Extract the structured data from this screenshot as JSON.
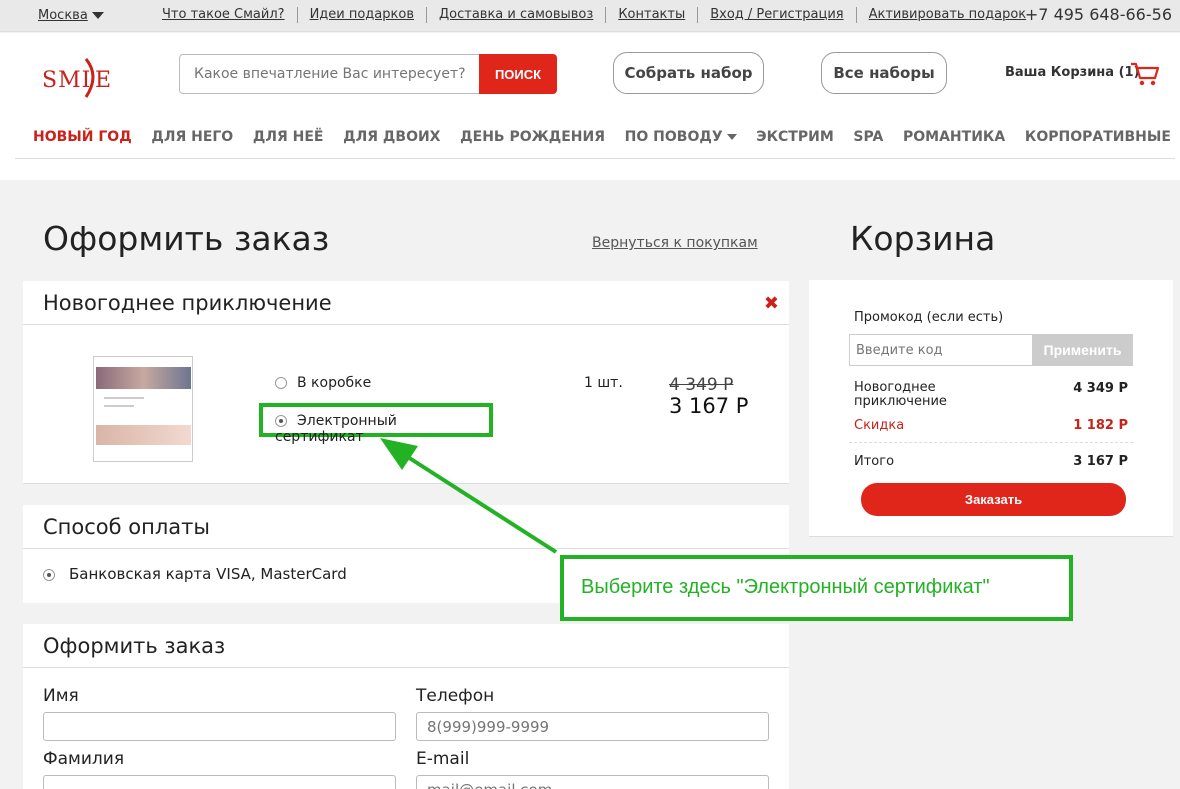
{
  "topbar": {
    "city": "Москва",
    "links": [
      "Что такое Смайл?",
      "Идеи подарков",
      "Доставка и самовывоз",
      "Контакты",
      "Вход / Регистрация",
      "Активировать подарок"
    ],
    "phone": "+7 495 648-66-56"
  },
  "header": {
    "logo": "SMILE",
    "search_placeholder": "Какое впечатление Вас интересует?",
    "search_button": "ПОИСК",
    "build_set": "Собрать набор",
    "all_sets": "Все наборы",
    "cart_label": "Ваша Корзина (1)"
  },
  "categories": [
    {
      "label": "НОВЫЙ ГОД",
      "active": true
    },
    {
      "label": "ДЛЯ НЕГО"
    },
    {
      "label": "ДЛЯ НЕЁ"
    },
    {
      "label": "ДЛЯ ДВОИХ"
    },
    {
      "label": "ДЕНЬ РОЖДЕНИЯ"
    },
    {
      "label": "ПО ПОВОДУ"
    },
    {
      "label": "ЭКСТРИМ"
    },
    {
      "label": "SPA"
    },
    {
      "label": "РОМАНТИКА"
    },
    {
      "label": "КОРПОРАТИВНЫЕ"
    }
  ],
  "checkout": {
    "title": "Оформить заказ",
    "back_link": "Вернуться к покупкам",
    "product": {
      "name": "Новогоднее приключение",
      "option_box": "В коробке",
      "option_cert": "Электронный сертификат",
      "selected_option": "option_cert",
      "quantity": "1 шт.",
      "old_price": "4 349 Р",
      "new_price": "3 167 Р"
    },
    "payment": {
      "title": "Способ оплаты",
      "method": "Банковская карта VISA, MasterCard"
    },
    "form": {
      "title": "Оформить заказ",
      "name_label": "Имя",
      "phone_label": "Телефон",
      "phone_placeholder": "8(999)999-9999",
      "surname_label": "Фамилия",
      "email_label": "E-mail",
      "email_placeholder": "mail@email.com"
    }
  },
  "cart": {
    "title": "Корзина",
    "promo_label": "Промокод (если есть)",
    "promo_placeholder": "Введите код",
    "promo_button": "Применить",
    "item_name": "Новогоднее приключение",
    "item_price": "4 349 Р",
    "discount_label": "Скидка",
    "discount_value": "1 182 Р",
    "total_label": "Итого",
    "total_value": "3 167 Р",
    "order_button": "Заказать"
  },
  "annotation": {
    "text": "Выберите здесь \"Электронный сертификат\"",
    "color": "#23b224"
  },
  "colors": {
    "brand_red": "#e0261b",
    "highlight_green": "#23b224"
  }
}
